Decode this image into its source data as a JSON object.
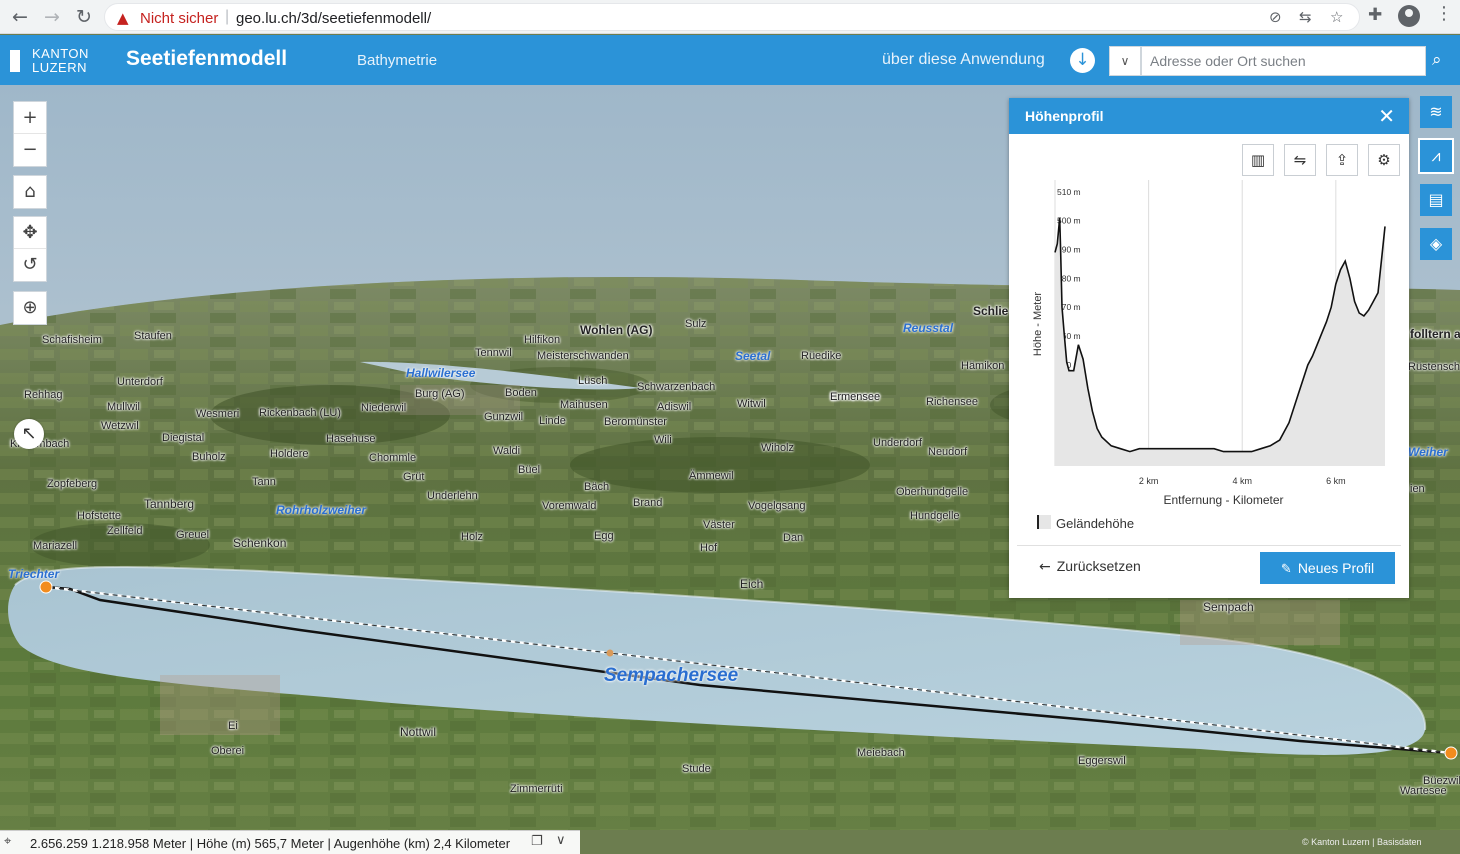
{
  "browser": {
    "back_icon": "arrow-left-icon",
    "forward_icon": "arrow-right-icon",
    "reload_icon": "reload-icon",
    "security_warning": "Nicht sicher",
    "url": "geo.lu.ch/3d/seetiefenmodell/"
  },
  "header": {
    "logo_line1": "KANTON",
    "logo_line2": "LUZERN",
    "title": "Seetiefenmodell",
    "subtitle": "Bathymetrie",
    "about": "über diese Anwendung",
    "search_placeholder": "Adresse oder Ort suchen"
  },
  "map_controls": [
    "zoom-in",
    "zoom-out",
    "home",
    "pan",
    "rotate",
    "locate",
    "compass"
  ],
  "right_tools": [
    "layers-icon",
    "profile-icon",
    "bookmark-icon",
    "basemap-icon"
  ],
  "places": [
    {
      "name": "Schafisheim",
      "cls": ""
    },
    {
      "name": "Staufen",
      "cls": ""
    },
    {
      "name": "Hilfikon",
      "cls": ""
    },
    {
      "name": "Wohlen (AG)",
      "cls": "bold"
    },
    {
      "name": "Sulz",
      "cls": ""
    },
    {
      "name": "Schlie",
      "cls": "bold"
    },
    {
      "name": "Reusstal",
      "cls": "water"
    },
    {
      "name": "Tennwil",
      "cls": ""
    },
    {
      "name": "Meisterschwanden",
      "cls": ""
    },
    {
      "name": "Seetal",
      "cls": "water"
    },
    {
      "name": "Rüedike",
      "cls": ""
    },
    {
      "name": "Hämikon",
      "cls": ""
    },
    {
      "name": "Hallwilersee",
      "cls": "water"
    },
    {
      "name": "Unterdorf",
      "cls": ""
    },
    {
      "name": "Lüsch",
      "cls": ""
    },
    {
      "name": "Schwarzenbach",
      "cls": ""
    },
    {
      "name": "Rehhag",
      "cls": ""
    },
    {
      "name": "Burg (AG)",
      "cls": ""
    },
    {
      "name": "Boden",
      "cls": ""
    },
    {
      "name": "Ermensee",
      "cls": ""
    },
    {
      "name": "Mullwil",
      "cls": ""
    },
    {
      "name": "Maihusen",
      "cls": ""
    },
    {
      "name": "Adiswil",
      "cls": ""
    },
    {
      "name": "Witwil",
      "cls": ""
    },
    {
      "name": "Richensee",
      "cls": ""
    },
    {
      "name": "Wesmeri",
      "cls": ""
    },
    {
      "name": "Rickenbach (LU)",
      "cls": ""
    },
    {
      "name": "Niederwil",
      "cls": ""
    },
    {
      "name": "Gunzwil",
      "cls": ""
    },
    {
      "name": "Linde",
      "cls": ""
    },
    {
      "name": "Beromünster",
      "cls": ""
    },
    {
      "name": "Wetzwil",
      "cls": ""
    },
    {
      "name": "Diegistal",
      "cls": ""
    },
    {
      "name": "Hasehuse",
      "cls": ""
    },
    {
      "name": "Wili",
      "cls": ""
    },
    {
      "name": "Underdorf",
      "cls": ""
    },
    {
      "name": "Krummbach",
      "cls": ""
    },
    {
      "name": "Waldi",
      "cls": ""
    },
    {
      "name": "Wiholz",
      "cls": ""
    },
    {
      "name": "Neudorf",
      "cls": ""
    },
    {
      "name": "Buholz",
      "cls": ""
    },
    {
      "name": "Holdere",
      "cls": ""
    },
    {
      "name": "Chommle",
      "cls": ""
    },
    {
      "name": "Büel",
      "cls": ""
    },
    {
      "name": "Ämmewil",
      "cls": ""
    },
    {
      "name": "Zopfeberg",
      "cls": ""
    },
    {
      "name": "Tann",
      "cls": ""
    },
    {
      "name": "Grüt",
      "cls": ""
    },
    {
      "name": "Bäch",
      "cls": ""
    },
    {
      "name": "Oberhundgelle",
      "cls": ""
    },
    {
      "name": "Underlehn",
      "cls": ""
    },
    {
      "name": "Tannberg",
      "cls": "big"
    },
    {
      "name": "Rohrholzweiher",
      "cls": "water"
    },
    {
      "name": "Voremwald",
      "cls": ""
    },
    {
      "name": "Brand",
      "cls": ""
    },
    {
      "name": "Vogelgsang",
      "cls": ""
    },
    {
      "name": "Hofstette",
      "cls": ""
    },
    {
      "name": "Hundgelle",
      "cls": ""
    },
    {
      "name": "Zellfeld",
      "cls": ""
    },
    {
      "name": "Greuel",
      "cls": ""
    },
    {
      "name": "Väster",
      "cls": ""
    },
    {
      "name": "Schenkon",
      "cls": "big"
    },
    {
      "name": "Holz",
      "cls": ""
    },
    {
      "name": "Egg",
      "cls": ""
    },
    {
      "name": "Dan",
      "cls": ""
    },
    {
      "name": "Mariazell",
      "cls": ""
    },
    {
      "name": "Hof",
      "cls": ""
    },
    {
      "name": "Triechter",
      "cls": "water"
    },
    {
      "name": "Eich",
      "cls": "big"
    },
    {
      "name": "Sempach",
      "cls": "big"
    },
    {
      "name": "Sempachersee",
      "cls": "water lake"
    },
    {
      "name": "Ei",
      "cls": ""
    },
    {
      "name": "Oberei",
      "cls": ""
    },
    {
      "name": "Nottwil",
      "cls": "big"
    },
    {
      "name": "Meiebach",
      "cls": ""
    },
    {
      "name": "Eggerswil",
      "cls": ""
    },
    {
      "name": "Stude",
      "cls": ""
    },
    {
      "name": "Zimmerrüti",
      "cls": ""
    },
    {
      "name": "Büezwil",
      "cls": ""
    },
    {
      "name": "Wartesee",
      "cls": ""
    },
    {
      "name": "Mittler Hupräch",
      "cls": ""
    },
    {
      "name": "Richensee",
      "cls": ""
    },
    {
      "name": "Ermensee",
      "cls": ""
    },
    {
      "name": "Rüstensch",
      "cls": ""
    },
    {
      "name": "folltern a",
      "cls": "bold"
    },
    {
      "name": "Weiher",
      "cls": "water"
    },
    {
      "name": "ien",
      "cls": ""
    }
  ],
  "panel": {
    "title": "Höhenprofil",
    "tools": [
      "statistics-icon",
      "swap-icon",
      "export-icon",
      "settings-icon"
    ],
    "legend": "Geländehöhe",
    "reset": "Zurücksetzen",
    "new_profile": "Neues Profil"
  },
  "chart_data": {
    "type": "area",
    "xlabel": "Entfernung - Kilometer",
    "ylabel": "Höhe - Meter",
    "ylim": [
      415,
      512
    ],
    "xlim": [
      0,
      7.2
    ],
    "x_ticks": [
      "2 km",
      "4 km",
      "6 km"
    ],
    "x_tick_values": [
      2,
      4,
      6
    ],
    "y_ticks": [
      "420 m",
      "430 m",
      "440 m",
      "450 m",
      "460 m",
      "470 m",
      "480 m",
      "490 m",
      "500 m",
      "510 m"
    ],
    "y_tick_values": [
      420,
      430,
      440,
      450,
      460,
      470,
      480,
      490,
      500,
      510
    ],
    "grid": true,
    "legend": "Geländehöhe",
    "series": [
      {
        "name": "Geländehöhe",
        "x": [
          0,
          0.05,
          0.1,
          0.12,
          0.15,
          0.2,
          0.25,
          0.3,
          0.4,
          0.5,
          0.6,
          0.7,
          0.8,
          0.9,
          1.0,
          1.2,
          1.4,
          1.6,
          1.8,
          2.0,
          2.2,
          2.4,
          2.6,
          2.8,
          3.0,
          3.2,
          3.4,
          3.6,
          3.8,
          4.0,
          4.2,
          4.4,
          4.6,
          4.8,
          5.0,
          5.2,
          5.4,
          5.5,
          5.6,
          5.7,
          5.8,
          5.9,
          6.0,
          6.1,
          6.2,
          6.3,
          6.4,
          6.5,
          6.6,
          6.7,
          6.8,
          6.9,
          7.0,
          7.05
        ],
        "y": [
          489,
          492,
          501,
          490,
          470,
          460,
          451,
          448,
          448,
          457,
          452,
          442,
          434,
          428,
          425,
          422,
          421,
          420,
          421,
          421,
          421,
          421,
          421,
          421,
          421,
          421,
          421,
          420,
          420,
          420,
          420,
          421,
          422,
          424,
          430,
          440,
          450,
          453,
          457,
          461,
          465,
          470,
          478,
          483,
          486,
          480,
          472,
          468,
          467,
          469,
          472,
          475,
          490,
          498
        ]
      }
    ]
  },
  "status": {
    "coordinates": "2.656.259 1.218.958 Meter | Höhe (m) 565,7 Meter | Augenhöhe (km) 2,4 Kilometer",
    "attribution": "© Kanton Luzern | Basisdaten"
  }
}
